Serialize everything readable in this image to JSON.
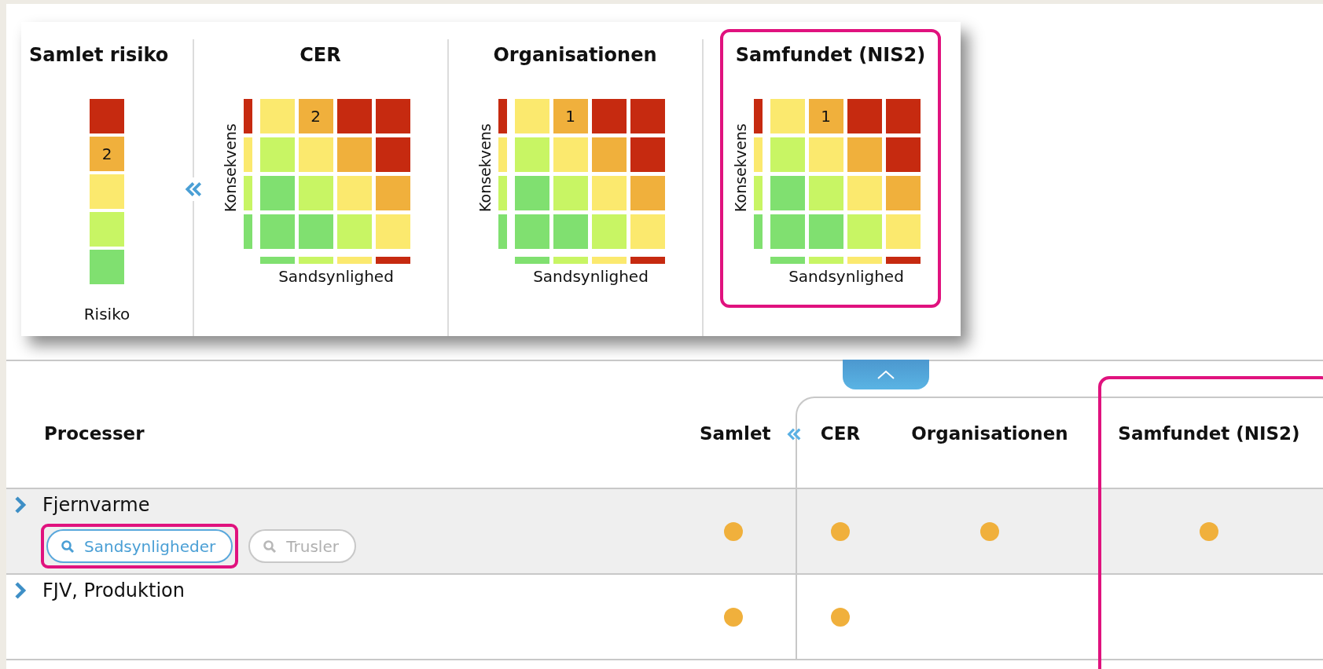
{
  "summary": {
    "title": "Samlet risiko",
    "label": "Risiko",
    "cells": [
      {
        "color": "#c62a10"
      },
      {
        "color": "#f0b03c",
        "label": "2"
      },
      {
        "color": "#fbe96e"
      },
      {
        "color": "#c8f564"
      },
      {
        "color": "#80e070"
      }
    ]
  },
  "matrices": [
    {
      "title": "CER",
      "ylabel": "Konsekvens",
      "xlabel": "Sandsynlighed",
      "highlighted": false,
      "y_scale": [
        {
          "color": "#c62a10"
        },
        {
          "color": "#fbe96e"
        },
        {
          "color": "#c8f564"
        },
        {
          "color": "#80e070"
        }
      ],
      "x_scale": [
        {
          "color": "#80e070"
        },
        {
          "color": "#c8f564"
        },
        {
          "color": "#fbe96e"
        },
        {
          "color": "#c62a10"
        }
      ],
      "rows": [
        [
          {
            "color": "#fbe96e"
          },
          {
            "color": "#f0b03c",
            "label": "2"
          },
          {
            "color": "#c62a10"
          },
          {
            "color": "#c62a10"
          }
        ],
        [
          {
            "color": "#c8f564"
          },
          {
            "color": "#fbe96e"
          },
          {
            "color": "#f0b03c"
          },
          {
            "color": "#c62a10"
          }
        ],
        [
          {
            "color": "#80e070"
          },
          {
            "color": "#c8f564"
          },
          {
            "color": "#fbe96e"
          },
          {
            "color": "#f0b03c"
          }
        ],
        [
          {
            "color": "#80e070"
          },
          {
            "color": "#80e070"
          },
          {
            "color": "#c8f564"
          },
          {
            "color": "#fbe96e"
          }
        ]
      ]
    },
    {
      "title": "Organisationen",
      "ylabel": "Konsekvens",
      "xlabel": "Sandsynlighed",
      "highlighted": false,
      "y_scale": [
        {
          "color": "#c62a10"
        },
        {
          "color": "#fbe96e"
        },
        {
          "color": "#c8f564"
        },
        {
          "color": "#80e070"
        }
      ],
      "x_scale": [
        {
          "color": "#80e070"
        },
        {
          "color": "#c8f564"
        },
        {
          "color": "#fbe96e"
        },
        {
          "color": "#c62a10"
        }
      ],
      "rows": [
        [
          {
            "color": "#fbe96e"
          },
          {
            "color": "#f0b03c",
            "label": "1"
          },
          {
            "color": "#c62a10"
          },
          {
            "color": "#c62a10"
          }
        ],
        [
          {
            "color": "#c8f564"
          },
          {
            "color": "#fbe96e"
          },
          {
            "color": "#f0b03c"
          },
          {
            "color": "#c62a10"
          }
        ],
        [
          {
            "color": "#80e070"
          },
          {
            "color": "#c8f564"
          },
          {
            "color": "#fbe96e"
          },
          {
            "color": "#f0b03c"
          }
        ],
        [
          {
            "color": "#80e070"
          },
          {
            "color": "#80e070"
          },
          {
            "color": "#c8f564"
          },
          {
            "color": "#fbe96e"
          }
        ]
      ]
    },
    {
      "title": "Samfundet (NIS2)",
      "ylabel": "Konsekvens",
      "xlabel": "Sandsynlighed",
      "highlighted": true,
      "y_scale": [
        {
          "color": "#c62a10"
        },
        {
          "color": "#fbe96e"
        },
        {
          "color": "#c8f564"
        },
        {
          "color": "#80e070"
        }
      ],
      "x_scale": [
        {
          "color": "#80e070"
        },
        {
          "color": "#c8f564"
        },
        {
          "color": "#fbe96e"
        },
        {
          "color": "#c62a10"
        }
      ],
      "rows": [
        [
          {
            "color": "#fbe96e"
          },
          {
            "color": "#f0b03c",
            "label": "1"
          },
          {
            "color": "#c62a10"
          },
          {
            "color": "#c62a10"
          }
        ],
        [
          {
            "color": "#c8f564"
          },
          {
            "color": "#fbe96e"
          },
          {
            "color": "#f0b03c"
          },
          {
            "color": "#c62a10"
          }
        ],
        [
          {
            "color": "#80e070"
          },
          {
            "color": "#c8f564"
          },
          {
            "color": "#fbe96e"
          },
          {
            "color": "#f0b03c"
          }
        ],
        [
          {
            "color": "#80e070"
          },
          {
            "color": "#80e070"
          },
          {
            "color": "#c8f564"
          },
          {
            "color": "#fbe96e"
          }
        ]
      ]
    }
  ],
  "table": {
    "columns": [
      {
        "label": "Processer"
      },
      {
        "label": "Samlet"
      },
      {
        "label": "CER",
        "highlighted": false
      },
      {
        "label": "Organisationen",
        "highlighted": false
      },
      {
        "label": "Samfundet (NIS2)",
        "highlighted": true
      }
    ],
    "rows": [
      {
        "name": "Fjernvarme",
        "selected": true,
        "expanded": false,
        "buttons": [
          {
            "label": "Sandsynligheder",
            "active": true,
            "highlighted": true
          },
          {
            "label": "Trusler",
            "active": false,
            "highlighted": false
          }
        ],
        "dots": [
          {
            "filled": true,
            "color": "#f0b03c"
          },
          {
            "filled": true,
            "color": "#f0b03c"
          },
          {
            "filled": true,
            "color": "#f0b03c"
          },
          {
            "filled": true,
            "color": "#f0b03c"
          }
        ]
      },
      {
        "name": "FJV, Produktion",
        "selected": false,
        "expanded": false,
        "dots": [
          {
            "filled": true,
            "color": "#f0b03c"
          },
          {
            "filled": true,
            "color": "#f0b03c"
          },
          {
            "filled": false
          },
          {
            "filled": false
          }
        ]
      }
    ]
  }
}
